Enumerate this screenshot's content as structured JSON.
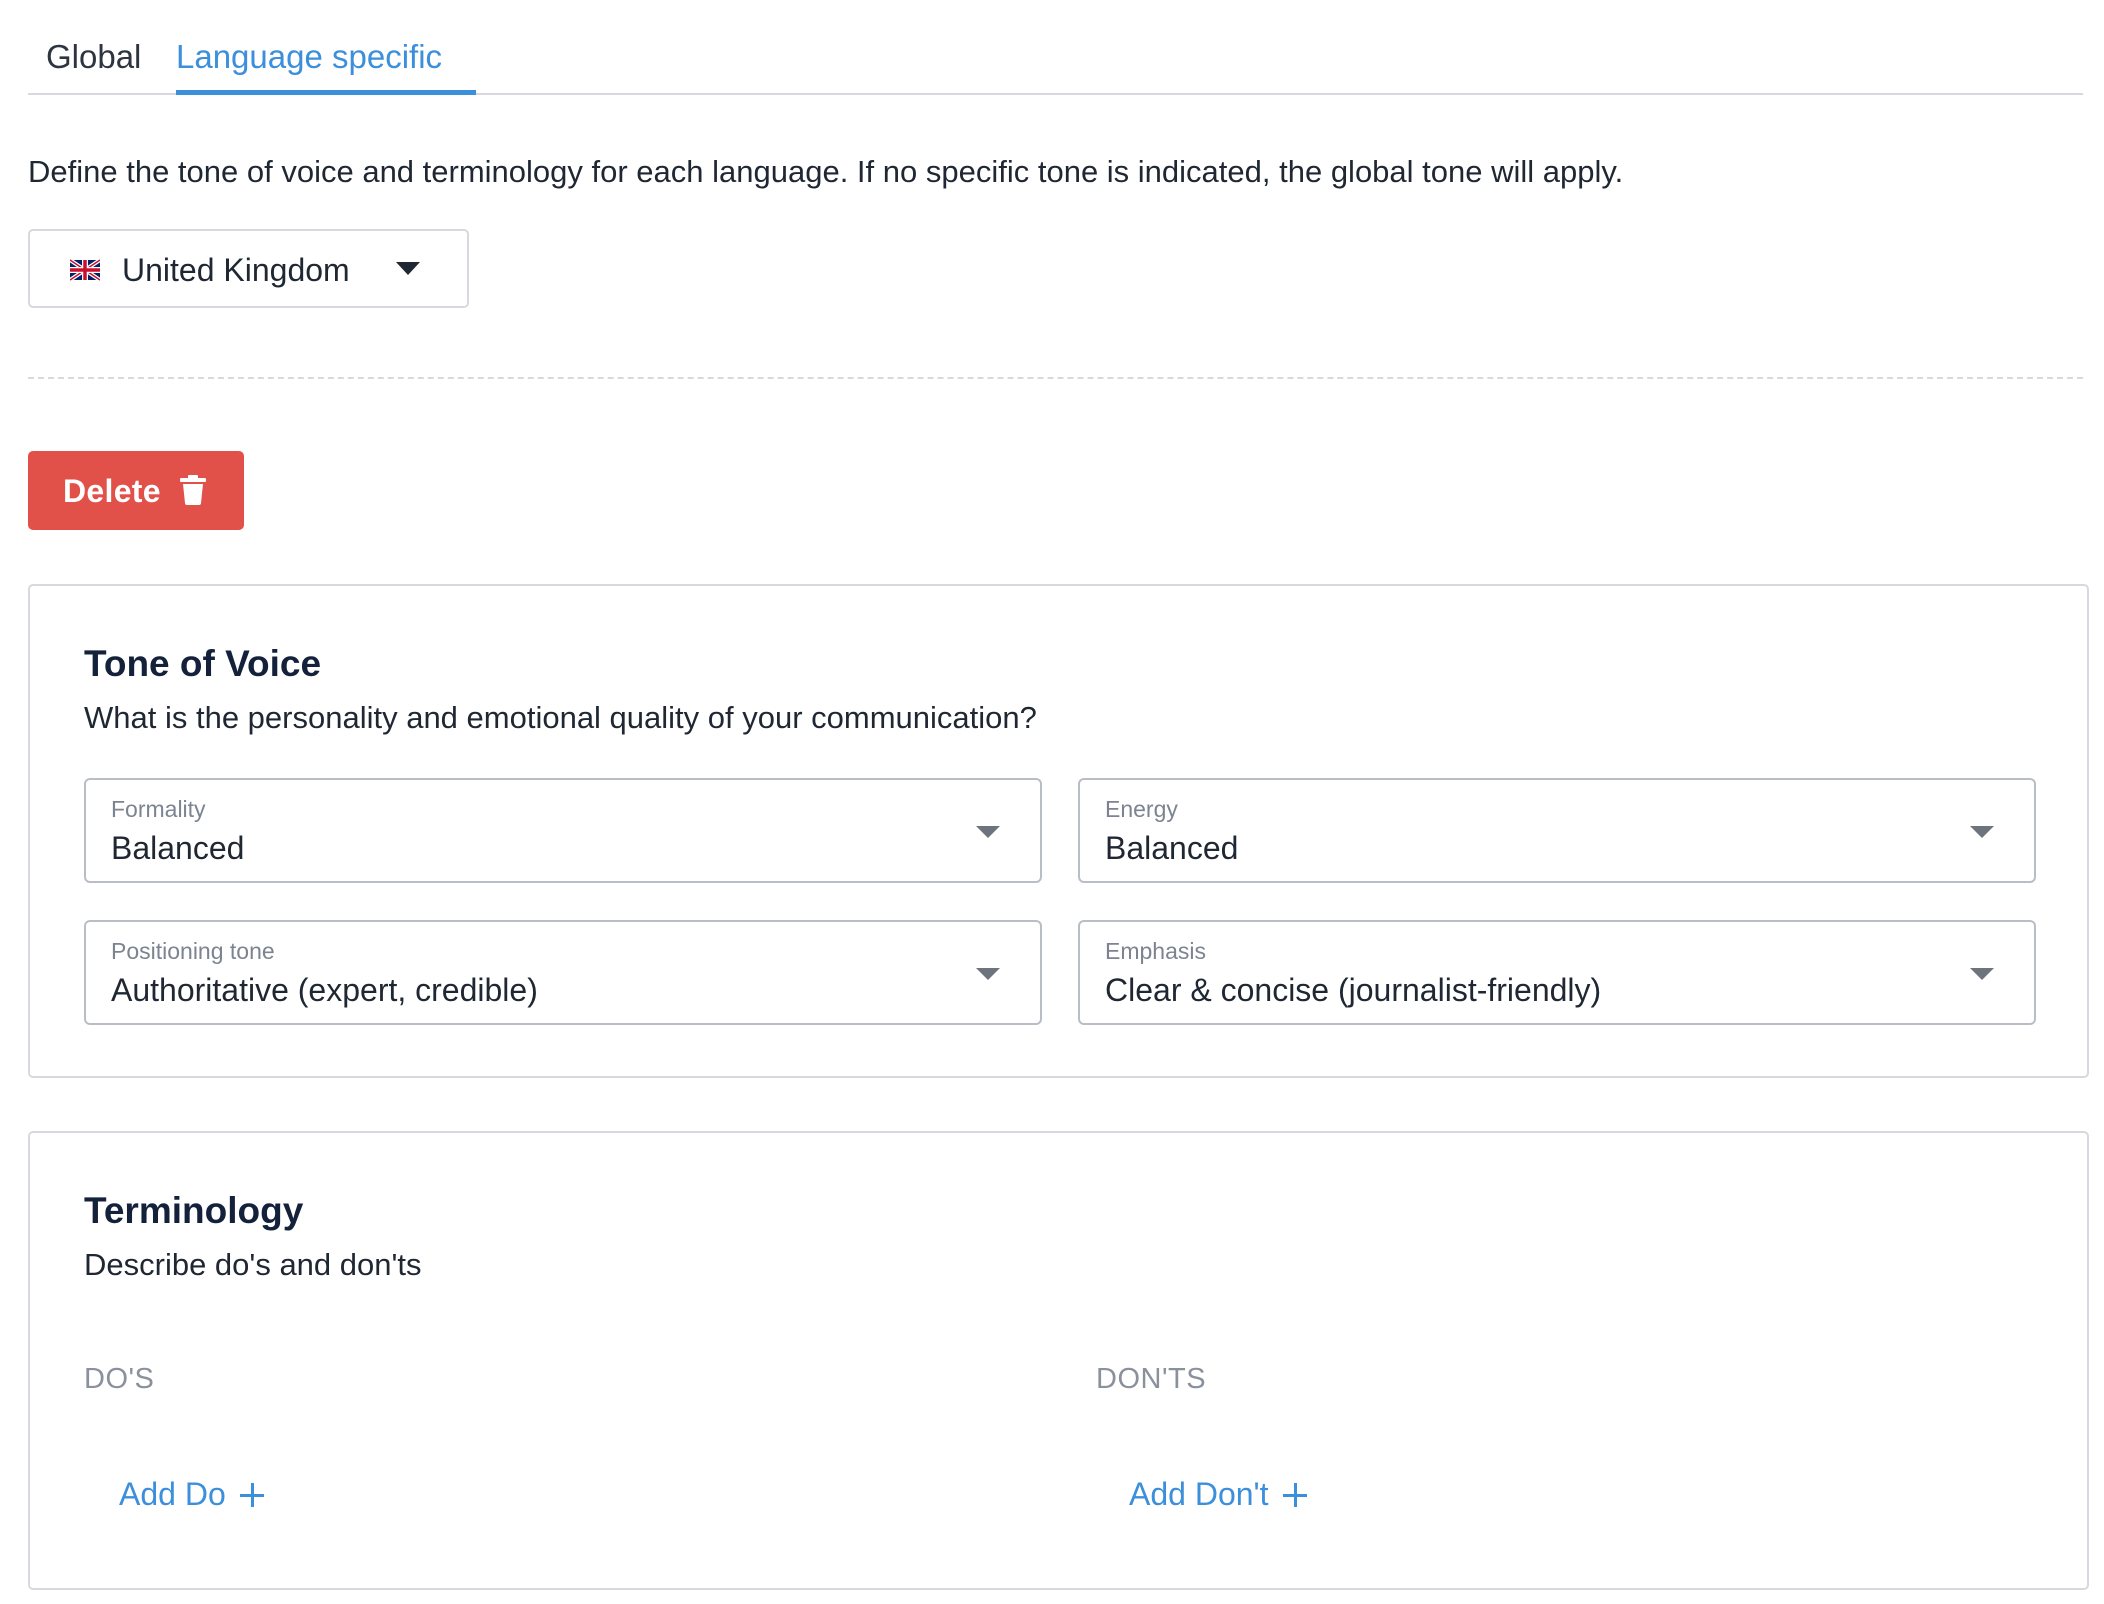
{
  "tabs": [
    {
      "label": "Global",
      "active": false
    },
    {
      "label": "Language specific",
      "active": true
    }
  ],
  "intro_text": "Define the tone of voice and terminology for each language. If no specific tone is indicated, the global tone will apply.",
  "country_select": {
    "value": "United Kingdom",
    "flag_icon": "uk-flag-icon"
  },
  "delete_button": {
    "label": "Delete",
    "icon": "trash-icon"
  },
  "tone_of_voice": {
    "title": "Tone of Voice",
    "subtitle": "What is the personality and emotional quality of your communication?",
    "fields": [
      {
        "label": "Formality",
        "value": "Balanced"
      },
      {
        "label": "Energy",
        "value": "Balanced"
      },
      {
        "label": "Positioning tone",
        "value": "Authoritative (expert, credible)"
      },
      {
        "label": "Emphasis",
        "value": "Clear & concise (journalist-friendly)"
      }
    ]
  },
  "terminology": {
    "title": "Terminology",
    "subtitle": "Describe do's and don'ts",
    "dos_heading": "DO'S",
    "donts_heading": "DON'TS",
    "add_do_label": "Add Do",
    "add_dont_label": "Add Don't"
  },
  "colors": {
    "accent": "#3c8fdb",
    "danger": "#e2504a",
    "border": "#d6d9de",
    "heading": "#14213a"
  }
}
